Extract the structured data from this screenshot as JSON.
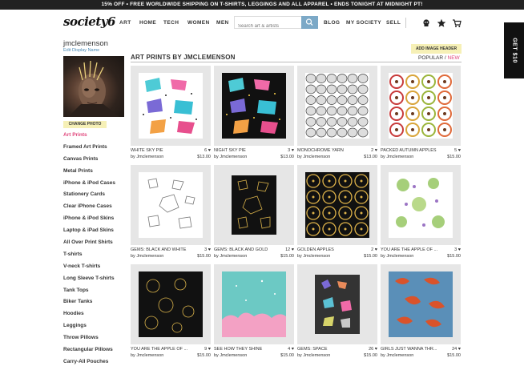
{
  "promo": "15% OFF • FREE WORLDWIDE SHIPPING ON T-SHIRTS, LEGGINGS AND ALL APPAREL • ENDS TONIGHT AT MIDNIGHT PT!",
  "header": {
    "logo": "society6",
    "nav_left": [
      "ART",
      "HOME",
      "TECH",
      "WOMEN",
      "MEN"
    ],
    "search_placeholder": "Search art & artists",
    "nav_right": [
      "BLOG",
      "MY SOCIETY",
      "SELL"
    ]
  },
  "gift_tab": "GET $10",
  "profile": {
    "username": "jmclemenson",
    "edit_label": "Edit Display Name",
    "change_photo": "CHANGE PHOTO",
    "add_header": "ADD IMAGE HEADER"
  },
  "sidebar": {
    "items": [
      {
        "label": "Art Prints",
        "active": true
      },
      {
        "label": "Framed Art Prints"
      },
      {
        "label": "Canvas Prints"
      },
      {
        "label": "Metal Prints"
      },
      {
        "label": "iPhone & iPod Cases"
      },
      {
        "label": "Stationery Cards"
      },
      {
        "label": "Clear iPhone Cases"
      },
      {
        "label": "iPhone & iPod Skins"
      },
      {
        "label": "Laptop & iPad Skins"
      },
      {
        "label": "All Over Print Shirts"
      },
      {
        "label": "T-shirts"
      },
      {
        "label": "V-neck T-shirts"
      },
      {
        "label": "Long Sleeve T-shirts"
      },
      {
        "label": "Tank Tops"
      },
      {
        "label": "Biker Tanks"
      },
      {
        "label": "Hoodies"
      },
      {
        "label": "Leggings"
      },
      {
        "label": "Throw Pillows"
      },
      {
        "label": "Rectangular Pillows"
      },
      {
        "label": "Carry-All Pouches"
      }
    ]
  },
  "main": {
    "title": "ART PRINTS BY JMCLEMENSON",
    "sort_popular": "POPULAR",
    "sort_sep": " / ",
    "sort_new": "NEW",
    "products": [
      {
        "title": "WHITE SKY PIE",
        "likes": "6 ♥",
        "by": "by Jmclemenson",
        "price": "$13.00"
      },
      {
        "title": "NIGHT SKY PIE",
        "likes": "3 ♥",
        "by": "by Jmclemenson",
        "price": "$13.00"
      },
      {
        "title": "MONOCHROME YARN",
        "likes": "2 ♥",
        "by": "by Jmclemenson",
        "price": "$13.00"
      },
      {
        "title": "PACKED AUTUMN APPLES",
        "likes": "5 ♥",
        "by": "by Jmclemenson",
        "price": "$15.00"
      },
      {
        "title": "GEMS: BLACK AND WHITE",
        "likes": "3 ♥",
        "by": "by Jmclemenson",
        "price": "$15.00"
      },
      {
        "title": "GEMS: BLACK AND GOLD",
        "likes": "12 ♥",
        "by": "by Jmclemenson",
        "price": "$15.00"
      },
      {
        "title": "GOLDEN APPLES",
        "likes": "2 ♥",
        "by": "by Jmclemenson",
        "price": "$15.00"
      },
      {
        "title": "YOU ARE THE APPLE OF ...",
        "likes": "3 ♥",
        "by": "by Jmclemenson",
        "price": "$15.00"
      },
      {
        "title": "YOU ARE THE APPLE OF ...",
        "likes": "9 ♥",
        "by": "by Jmclemenson",
        "price": "$15.00"
      },
      {
        "title": "SEE HOW THEY SHINE",
        "likes": "4 ♥",
        "by": "by Jmclemenson",
        "price": "$15.00"
      },
      {
        "title": "GEMS: SPACE",
        "likes": "26 ♥",
        "by": "by Jmclemenson",
        "price": "$15.00"
      },
      {
        "title": "GIRLS JUST WANNA THR...",
        "likes": "24 ♥",
        "by": "by Jmclemenson",
        "price": "$15.00"
      }
    ]
  },
  "colors": {
    "accent_pink": "#e0457b",
    "search_blue": "#7ca9c7",
    "highlight_yellow": "#f6f0b6"
  }
}
